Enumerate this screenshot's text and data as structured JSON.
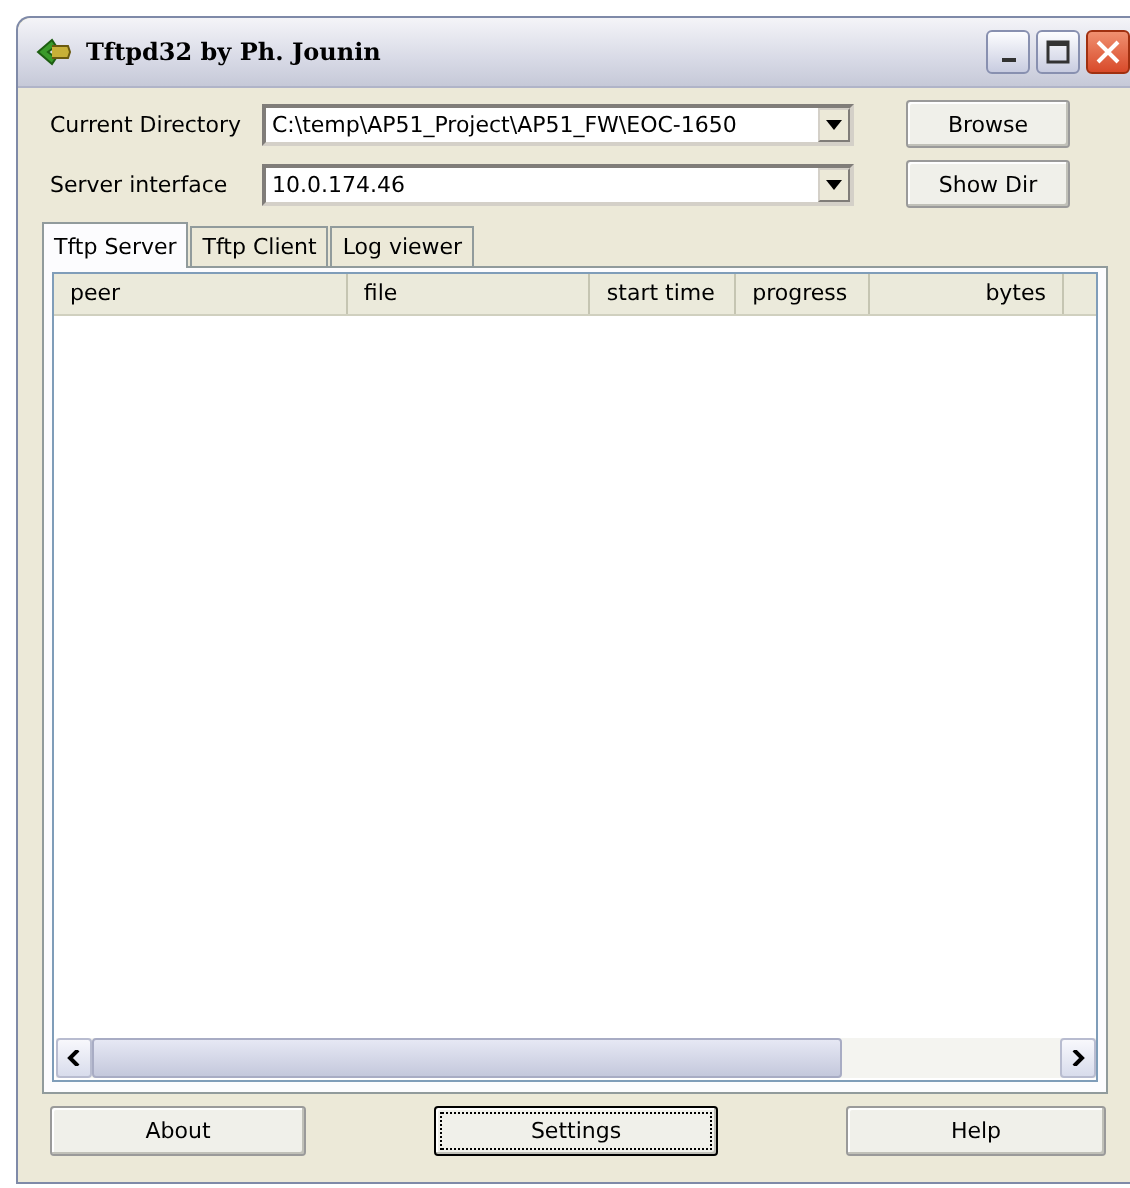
{
  "window": {
    "title": "Tftpd32 by Ph. Jounin"
  },
  "fields": [
    {
      "label": "Current Directory",
      "value": "C:\\temp\\AP51_Project\\AP51_FW\\EOC-1650",
      "button": "Browse"
    },
    {
      "label": "Server interface",
      "value": "10.0.174.46",
      "button": "Show Dir"
    }
  ],
  "tabs": [
    {
      "label": "Tftp Server",
      "selected": true
    },
    {
      "label": "Tftp Client",
      "selected": false
    },
    {
      "label": "Log viewer",
      "selected": false
    }
  ],
  "table": {
    "columns": [
      "peer",
      "file",
      "start time",
      "progress",
      "bytes"
    ]
  },
  "buttons": [
    {
      "label": "About",
      "focused": false
    },
    {
      "label": "Settings",
      "focused": true
    },
    {
      "label": "Help",
      "focused": false
    }
  ]
}
